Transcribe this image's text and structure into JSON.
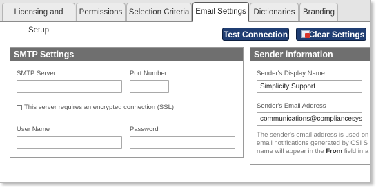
{
  "tabs": [
    {
      "label": "Licensing and Setup",
      "active": false
    },
    {
      "label": "Permissions",
      "active": false
    },
    {
      "label": "Selection Criteria",
      "active": false
    },
    {
      "label": "Email Settings",
      "active": true
    },
    {
      "label": "Dictionaries",
      "active": false
    },
    {
      "label": "Branding",
      "active": false
    }
  ],
  "toolbar": {
    "test_connection_label": "Test Connection",
    "clear_settings_label": "Clear Settings",
    "clear_settings_icon": "clear-settings-icon"
  },
  "smtp": {
    "title": "SMTP Settings",
    "server_label": "SMTP Server",
    "server_value": "",
    "port_label": "Port Number",
    "port_value": "",
    "ssl_label": "This server requires an encrypted connection (SSL)",
    "ssl_checked": false,
    "username_label": "User Name",
    "username_value": "",
    "password_label": "Password",
    "password_value": ""
  },
  "sender": {
    "title": "Sender information",
    "display_name_label": "Sender's Display Name",
    "display_name_value": "Simplicity Support",
    "email_label": "Sender's Email Address",
    "email_value": "communications@compliancesyst",
    "note_line1": "The sender's email address is used on",
    "note_line2": "email notifications generated by CSI S",
    "note_line3_before": "name will appear in the ",
    "note_line3_bold": "From",
    "note_line3_after": " field in a"
  },
  "colors": {
    "button_bg": "#1f3d72",
    "panel_header_bg": "#6f6f6f",
    "tabbar_bg": "#e4e4e4"
  }
}
